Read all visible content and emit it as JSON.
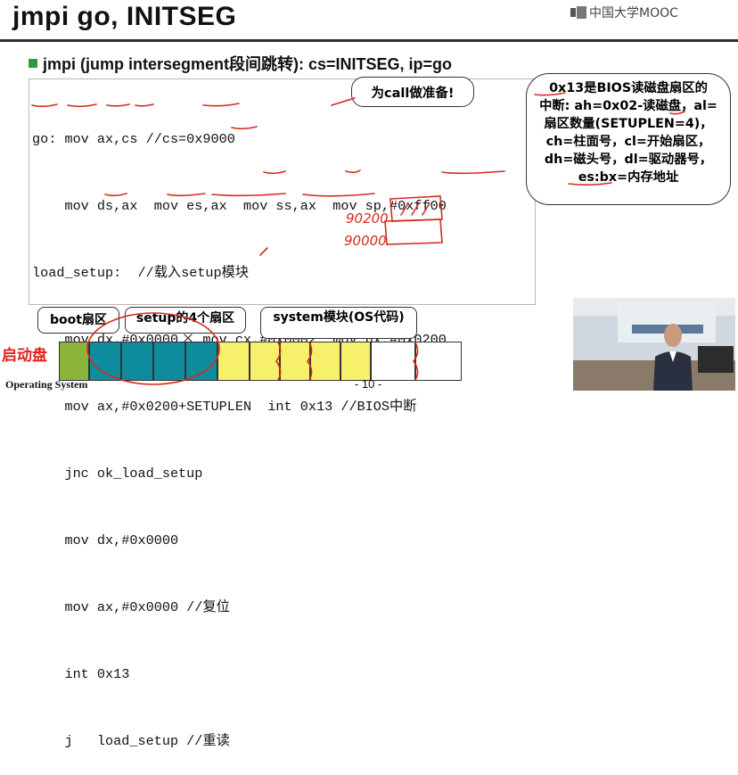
{
  "slide": {
    "title": "jmpi go, INITSEG",
    "logo_text": "中国大学MOOC",
    "subtitle": "jmpi (jump intersegment段间跳转): cs=INITSEG, ip=go",
    "footer_left": "Operating System",
    "footer_page": "- 10 -"
  },
  "code_lines": [
    "go: mov ax,cs //cs=0x9000",
    "    mov ds,ax  mov es,ax  mov ss,ax  mov sp,#0xff00",
    "load_setup:  //载入setup模块",
    "    mov dx,#0x0000   mov cx,#0x0002  mov bx,#0x0200",
    "    mov ax,#0x0200+SETUPLEN  int 0x13 //BIOS中断",
    "    jnc ok_load_setup",
    "    mov dx,#0x0000",
    "    mov ax,#0x0000 //复位",
    "    int 0x13",
    "    j   load_setup //重读"
  ],
  "cloud_note": "为call做准备!",
  "callout_lines": [
    "0x13是BIOS读磁盘扇区的",
    "中断: ah=0x02-读磁盘，al=",
    "扇区数量(SETUPLEN=4)，",
    "ch=柱面号，cl=开始扇区，",
    "dh=磁头号，dl=驱动器号，",
    "es:bx=内存地址"
  ],
  "disk": {
    "label": "启动盘",
    "boot_label": "boot扇区",
    "setup_label": "setup的4个扇区",
    "system_label": "system模块(OS代码)"
  },
  "handwriting": {
    "note1": "90200",
    "note2": "90000"
  },
  "colors": {
    "boot_sector": "#8db43a",
    "setup_sector": "#0f8b9e",
    "system_sector": "#f6f06a",
    "annotation": "#d62a1e",
    "bullet": "#2f9a3a"
  }
}
